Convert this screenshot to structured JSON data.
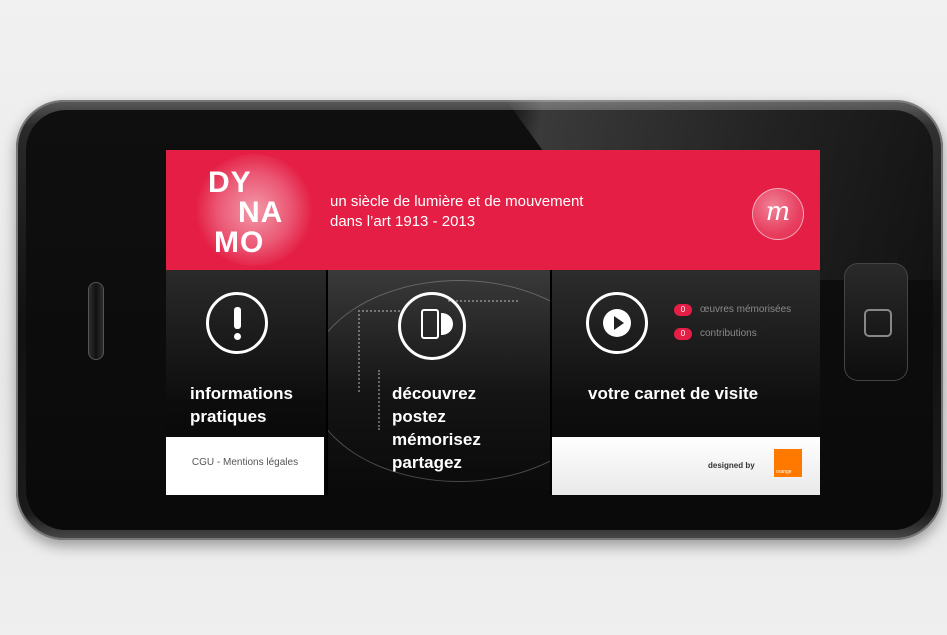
{
  "brand": {
    "logo_lines": [
      "DY",
      "NA",
      "MO"
    ],
    "tagline_line1": "un siècle de lumière et de mouvement",
    "tagline_line2": "dans l’art 1913 - 2013",
    "badge_letter": "m",
    "accent_color": "#e41e44"
  },
  "tiles": {
    "info": {
      "icon": "exclamation-icon",
      "label_line1": "informations",
      "label_line2": "pratiques",
      "footer_link": "CGU - Mentions légales"
    },
    "discover": {
      "icon": "phone-icon",
      "lines": [
        "découvrez",
        "postez",
        "mémorisez",
        "partagez"
      ]
    },
    "visit": {
      "icon": "play-icon",
      "label": "votre carnet de visite",
      "stats": [
        {
          "count": "0",
          "label": "œuvres mémorisées"
        },
        {
          "count": "0",
          "label": "contributions"
        }
      ],
      "designed_by": "designed by",
      "partner_logo_text": "orange",
      "partner_color": "#ff7900"
    }
  }
}
